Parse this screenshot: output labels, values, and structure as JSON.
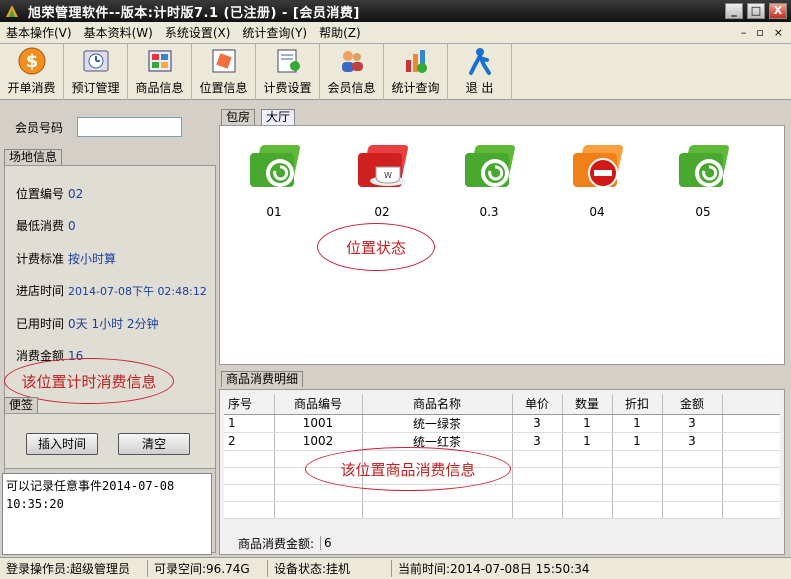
{
  "window": {
    "title": "旭荣管理软件--版本:计时版7.1 (已注册) - [会员消费]",
    "min_label": "_",
    "max_label": "□",
    "close_label": "X"
  },
  "menu": {
    "items": [
      "基本操作(V)",
      "基本资料(W)",
      "系统设置(X)",
      "统计查询(Y)",
      "帮助(Z)"
    ],
    "mdi_controls": [
      "–",
      "▫",
      "×"
    ]
  },
  "toolbar": {
    "buttons": [
      {
        "label": "开单消费",
        "icon": "dollar-icon"
      },
      {
        "label": "预订管理",
        "icon": "clock-icon"
      },
      {
        "label": "商品信息",
        "icon": "grid-icon"
      },
      {
        "label": "位置信息",
        "icon": "card-icon"
      },
      {
        "label": "计费设置",
        "icon": "settings-icon"
      },
      {
        "label": "会员信息",
        "icon": "users-icon"
      },
      {
        "label": "统计查询",
        "icon": "chart-icon"
      },
      {
        "label": "退 出",
        "icon": "exit-icon"
      }
    ]
  },
  "left": {
    "member_label": "会员号码",
    "member_value": "",
    "site_tab": "场地信息",
    "fields": [
      {
        "label": "位置编号",
        "value": "02"
      },
      {
        "label": "最低消费",
        "value": "0"
      },
      {
        "label": "计费标准",
        "value": "按小时算"
      },
      {
        "label": "进店时间",
        "value": "2014-07-08下午 02:48:12"
      },
      {
        "label": "已用时间",
        "value": "0天 1小时 2分钟"
      },
      {
        "label": "消费金额",
        "value": "16"
      }
    ],
    "timing_annotation": "该位置计时消费信息",
    "note_tab": "便签",
    "insert_time_button": "插入时间",
    "clear_button": "清空",
    "note_text": "可以记录任意事件2014-07-08\n10:35:20"
  },
  "right": {
    "tabs": [
      "包房",
      "大厅"
    ],
    "positions": [
      {
        "name": "01",
        "status": "available",
        "color": "#48a830"
      },
      {
        "name": "02",
        "status": "occupied",
        "color": "#d02020"
      },
      {
        "name": "0.3",
        "status": "available",
        "color": "#48a830"
      },
      {
        "name": "04",
        "status": "disabled",
        "color": "#f08018"
      },
      {
        "name": "05",
        "status": "available",
        "color": "#48a830"
      }
    ],
    "status_annotation": "位置状态",
    "detail_tab": "商品消费明细",
    "columns": [
      "序号",
      "商品编号",
      "商品名称",
      "单价",
      "数量",
      "折扣",
      "金额"
    ],
    "rows": [
      [
        "1",
        "1001",
        "统一绿茶",
        "3",
        "1",
        "1",
        "3"
      ],
      [
        "2",
        "1002",
        "统一红茶",
        "3",
        "1",
        "1",
        "3"
      ]
    ],
    "goods_annotation": "该位置商品消费信息",
    "total_label": "商品消费金额:",
    "total_value": "6"
  },
  "status": {
    "operator": "登录操作员:超级管理员",
    "space": "可录空间:96.74G",
    "device": "设备状态:挂机",
    "time": "当前时间:2014-07-08日 15:50:34"
  }
}
